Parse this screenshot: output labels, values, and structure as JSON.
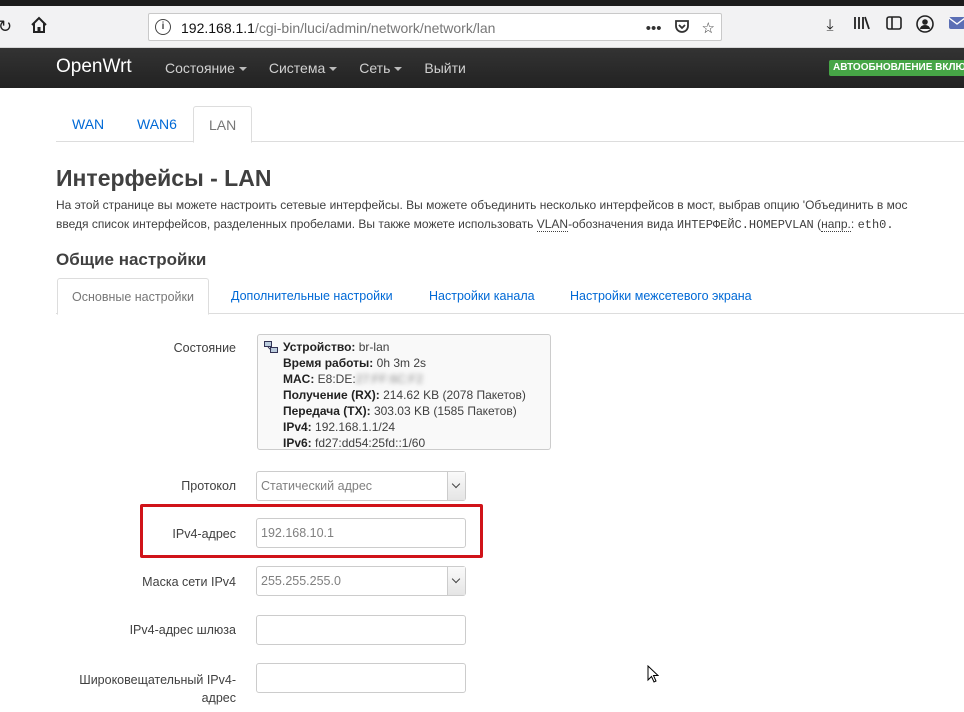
{
  "browser": {
    "url_host": "192.168.1.1",
    "url_path": "/cgi-bin/luci/admin/network/network/lan"
  },
  "header": {
    "brand": "OpenWrt",
    "menu": [
      {
        "label": "Состояние",
        "has_caret": true
      },
      {
        "label": "Система",
        "has_caret": true
      },
      {
        "label": "Сеть",
        "has_caret": true
      },
      {
        "label": "Выйти",
        "has_caret": false
      }
    ],
    "badge": "АВТООБНОВЛЕНИЕ ВКЛЮ",
    "badge_color": "#46a546"
  },
  "interface_tabs": [
    {
      "label": "WAN",
      "active": false
    },
    {
      "label": "WAN6",
      "active": false
    },
    {
      "label": "LAN",
      "active": true
    }
  ],
  "page": {
    "title": "Интерфейсы - LAN",
    "desc_line1": "На этой странице вы можете настроить сетевые интерфейсы. Вы можете объединить несколько интерфейсов в мост, выбрав опцию 'Объединить в мос",
    "desc_line2_a": "введя список интерфейсов, разделенных пробелами. Вы также можете использовать ",
    "desc_line2_vlan": "VLAN",
    "desc_line2_b": "-обозначения вида ",
    "desc_line2_mono": "ИНТЕРФЕЙС.НОМЕРVLAN",
    "desc_line2_c": " (",
    "desc_line2_abbr": "напр.",
    "desc_line2_d": ": ",
    "desc_line2_mono2": "eth0."
  },
  "section": {
    "title": "Общие настройки",
    "tabs": [
      {
        "label": "Основные настройки",
        "active": true
      },
      {
        "label": "Дополнительные настройки",
        "active": false
      },
      {
        "label": "Настройки канала",
        "active": false
      },
      {
        "label": "Настройки межсетевого экрана",
        "active": false
      }
    ]
  },
  "form": {
    "status_label": "Состояние",
    "status": {
      "device_key": "Устройство:",
      "device_val": "br-lan",
      "uptime_key": "Время работы:",
      "uptime_val": "0h 3m 2s",
      "mac_key": "MAC:",
      "mac_val_visible": "E8:DE:",
      "mac_val_blurred": "27:FF:6C:F2",
      "rx_key": "Получение (RX):",
      "rx_val": "214.62 KB (2078 Пакетов)",
      "tx_key": "Передача (TX):",
      "tx_val": "303.03 KB (1585 Пакетов)",
      "ipv4_key": "IPv4:",
      "ipv4_val": "192.168.1.1/24",
      "ipv6_key": "IPv6:",
      "ipv6_val": "fd27:dd54:25fd::1/60"
    },
    "protocol_label": "Протокол",
    "protocol_value": "Статический адрес",
    "ipv4_label": "IPv4-адрес",
    "ipv4_value": "192.168.10.1",
    "netmask_label": "Маска сети IPv4",
    "netmask_value": "255.255.255.0",
    "gateway_label": "IPv4-адрес шлюза",
    "gateway_value": "",
    "broadcast_label_1": "Широковещательный IPv4-",
    "broadcast_label_2": "адрес",
    "broadcast_value": ""
  },
  "colors": {
    "link": "#0069d6",
    "highlight": "#d01319"
  }
}
